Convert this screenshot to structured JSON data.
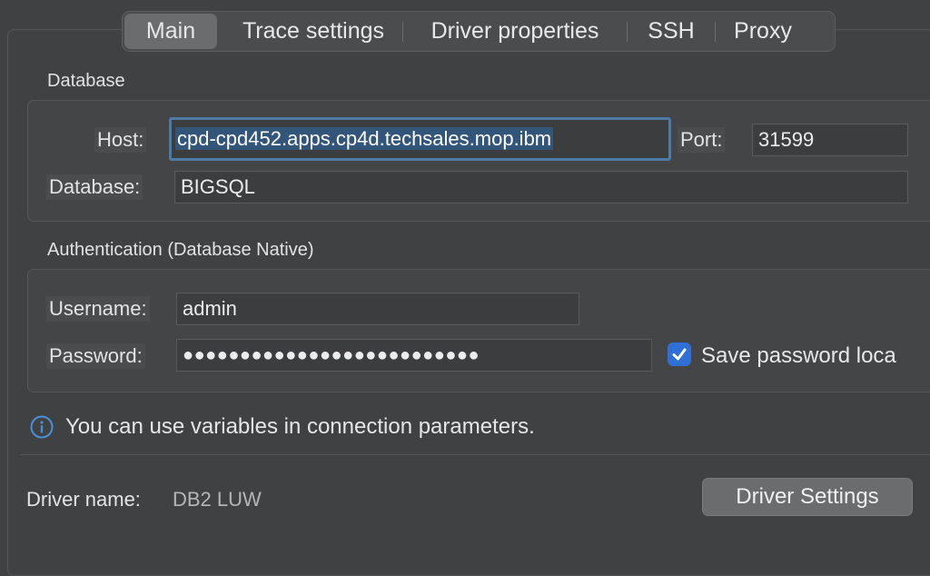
{
  "tabs": [
    "Main",
    "Trace settings",
    "Driver properties",
    "SSH",
    "Proxy"
  ],
  "database_section": {
    "title": "Database",
    "host_label": "Host:",
    "host_value": "cpd-cpd452.apps.cp4d.techsales.mop.ibm",
    "port_label": "Port:",
    "port_value": "31599",
    "database_label": "Database:",
    "database_value": "BIGSQL"
  },
  "auth_section": {
    "title": "Authentication (Database Native)",
    "username_label": "Username:",
    "username_value": "admin",
    "password_label": "Password:",
    "password_value": "●●●●●●●●●●●●●●●●●●●●●●●●●●",
    "save_password_label": "Save password loca",
    "save_password_checked": true
  },
  "info_text": "You can use variables in connection parameters.",
  "driver": {
    "name_label": "Driver name:",
    "name_value": "DB2 LUW",
    "settings_button": "Driver Settings"
  },
  "colors": {
    "accent": "#2f6fd6",
    "focus_border": "#4e7aa8",
    "selection": "#33557a"
  }
}
